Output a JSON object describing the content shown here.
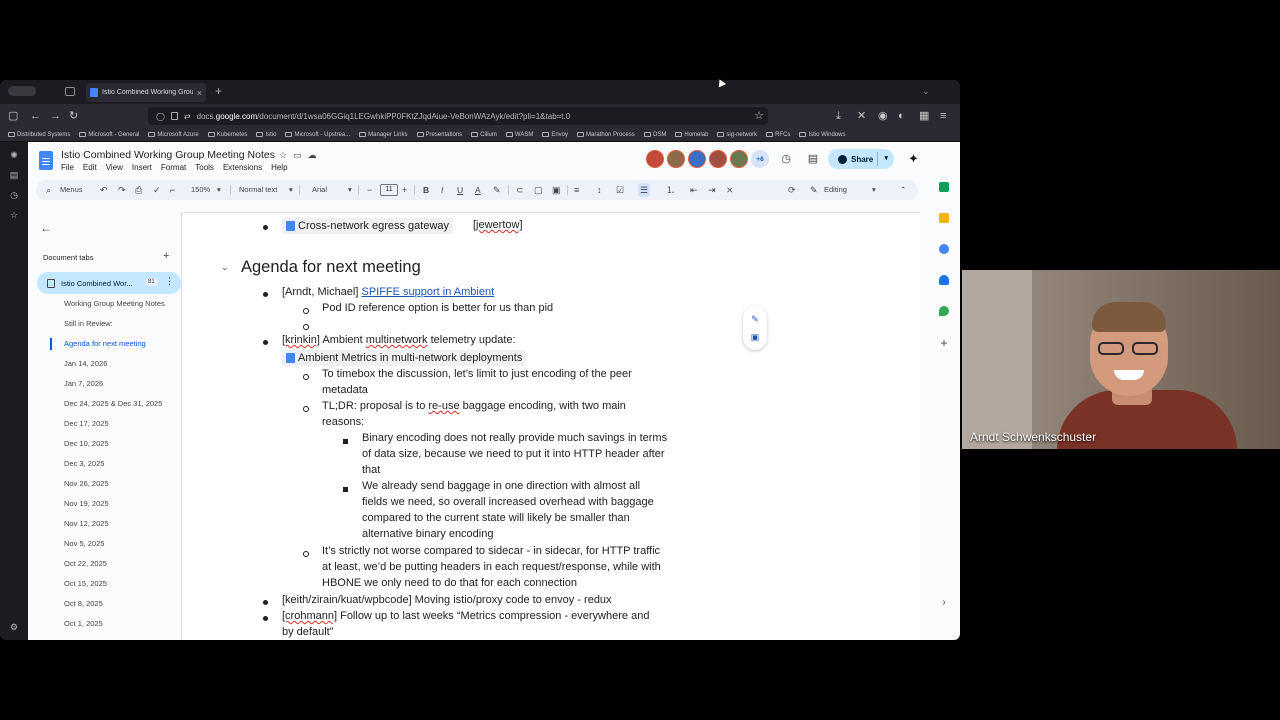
{
  "browser": {
    "tab_title": "Istio Combined Working Group I",
    "url_prefix": "docs.",
    "url_host": "google.com",
    "url_path": "/document/d/1wsa06GGiq1LEGwhkiPP0FKtZJqdAiue-VeBonWAzAyk/edit?pli=1&tab=t.0",
    "bookmarks": [
      "Distributed Systems",
      "Microsoft - General",
      "Microsoft Azure",
      "Kubernetes",
      "Istio",
      "Microsoft - Upstrea...",
      "Manager Links",
      "Presentations",
      "Cilium",
      "WASM",
      "Envoy",
      "Marathon Process",
      "OSM",
      "Homelab",
      "sig-network",
      "RFCs",
      "Istio Windows"
    ]
  },
  "doc": {
    "title": "Istio Combined Working Group Meeting Notes",
    "menu": [
      "File",
      "Edit",
      "View",
      "Insert",
      "Format",
      "Tools",
      "Extensions",
      "Help"
    ],
    "collaborators_more": "+6",
    "share_label": "Share",
    "toolbar": {
      "menus": "Menus",
      "zoom": "150%",
      "style": "Normal text",
      "font": "Arial",
      "font_size": "11",
      "mode": "Editing"
    }
  },
  "outline": {
    "header": "Document tabs",
    "active_tab": "Istio Combined Wor...",
    "active_count": "81",
    "items": [
      "Working Group Meeting Notes",
      "Still in Review:",
      "Agenda for next meeting",
      "Jan 14, 2026",
      "Jan 7, 2026",
      "Dec 24, 2025 & Dec 31, 2025",
      "Dec 17, 2025",
      "Dec 10, 2025",
      "Dec 3, 2025",
      "Nov 26, 2025",
      "Nov 19, 2025",
      "Nov 12, 2025",
      "Nov 5, 2025",
      "Oct 22, 2025",
      "Oct 15, 2025",
      "Oct 8, 2025",
      "Oct 1, 2025"
    ]
  },
  "content": {
    "chip_egress": "Cross-network egress gateway",
    "egress_owner": "[jewertow]",
    "heading": "Agenda for next meeting",
    "item1_owner": "[Arndt, Michael]",
    "item1_link": "SPIFFE support in Ambient",
    "item1_sub1": "Pod ID reference option is better for us than pid",
    "item2_owner": "[krinkin]",
    "item2_text_a": "Ambient",
    "item2_text_b": "multinetwork",
    "item2_text_c": "telemetry update:",
    "item2_chip": "Ambient Metrics in multi-network deployments",
    "item2_sub1_l1": "To timebox the discussion, let’s limit to just encoding of the peer",
    "item2_sub1_l2": "metadata",
    "item2_sub2_l1a": "TL;DR: proposal is to",
    "item2_sub2_l1b": "re-use",
    "item2_sub2_l1c": "baggage encoding, with two main",
    "item2_sub2_l2": "reasons:",
    "item2_sq1_l1": "Binary encoding does not really provide much savings in terms",
    "item2_sq1_l2": "of data size, because we need to put it into HTTP header after",
    "item2_sq1_l3": "that",
    "item2_sq2_l1": "We already send baggage in one direction with almost all",
    "item2_sq2_l2": "fields we need, so overall increased overhead with baggage",
    "item2_sq2_l3": "compared to the current state will likely be smaller than",
    "item2_sq2_l4": "alternative binary encoding",
    "item2_sub3_l1": "It’s strictly not worse compared to sidecar - in sidecar, for HTTP traffic",
    "item2_sub3_l2": "at least, we’d be putting headers in each request/response, while with",
    "item2_sub3_l3": "HBONE we only need to do that for each connection",
    "item3": "[keith/zirain/kuat/wpbcode] Moving istio/proxy code to envoy - redux",
    "item4_owner": "[crohmann]",
    "item4_l1": "Follow up to last weeks “Metrics compression - everywhere and",
    "item4_l2": "by default”"
  },
  "video": {
    "participant_name": "Arndt Schwenkschuster"
  }
}
